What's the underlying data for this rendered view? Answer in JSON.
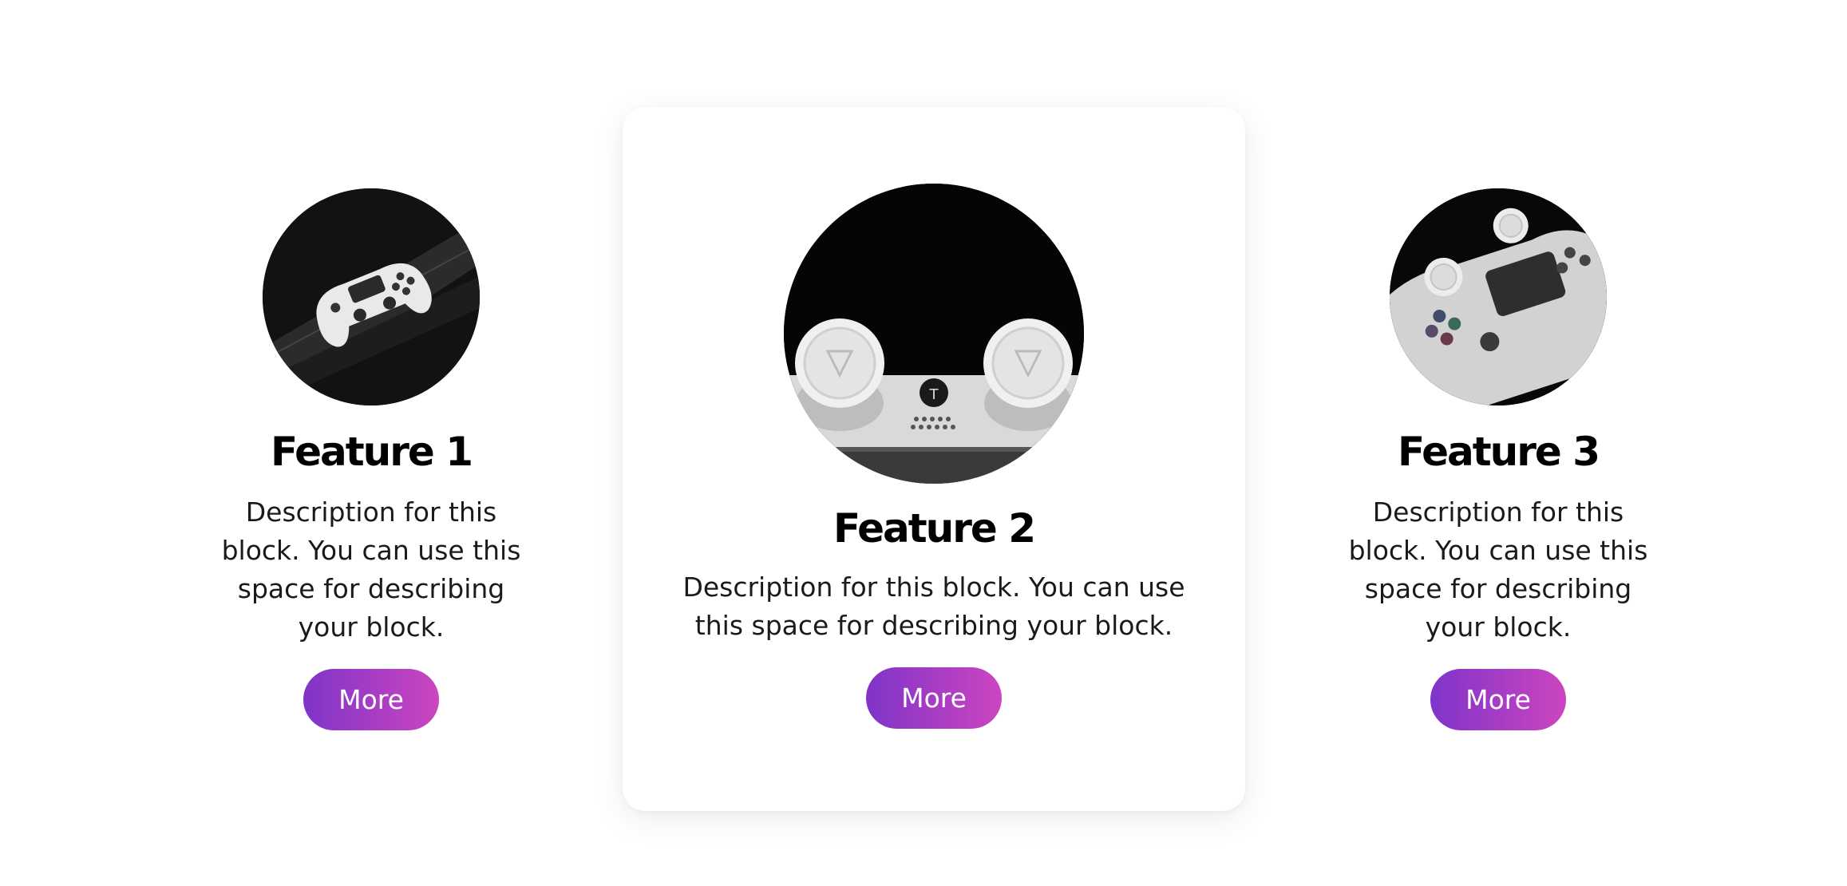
{
  "features": [
    {
      "title": "Feature 1",
      "description": "Description for this block. You can use this space for describing your block.",
      "button_label": "More",
      "image_icon": "gamepad-photo-icon"
    },
    {
      "title": "Feature 2",
      "description": "Description for this block. You can use this space for describing your block.",
      "button_label": "More",
      "image_icon": "gamepad-thumbsticks-photo-icon"
    },
    {
      "title": "Feature 3",
      "description": "Description for this block. You can use this space for describing your block.",
      "button_label": "More",
      "image_icon": "gamepad-closeup-photo-icon"
    }
  ],
  "colors": {
    "button_gradient_start": "#7f34c9",
    "button_gradient_end": "#cc45c0",
    "title": "#000000",
    "background": "#ffffff"
  }
}
